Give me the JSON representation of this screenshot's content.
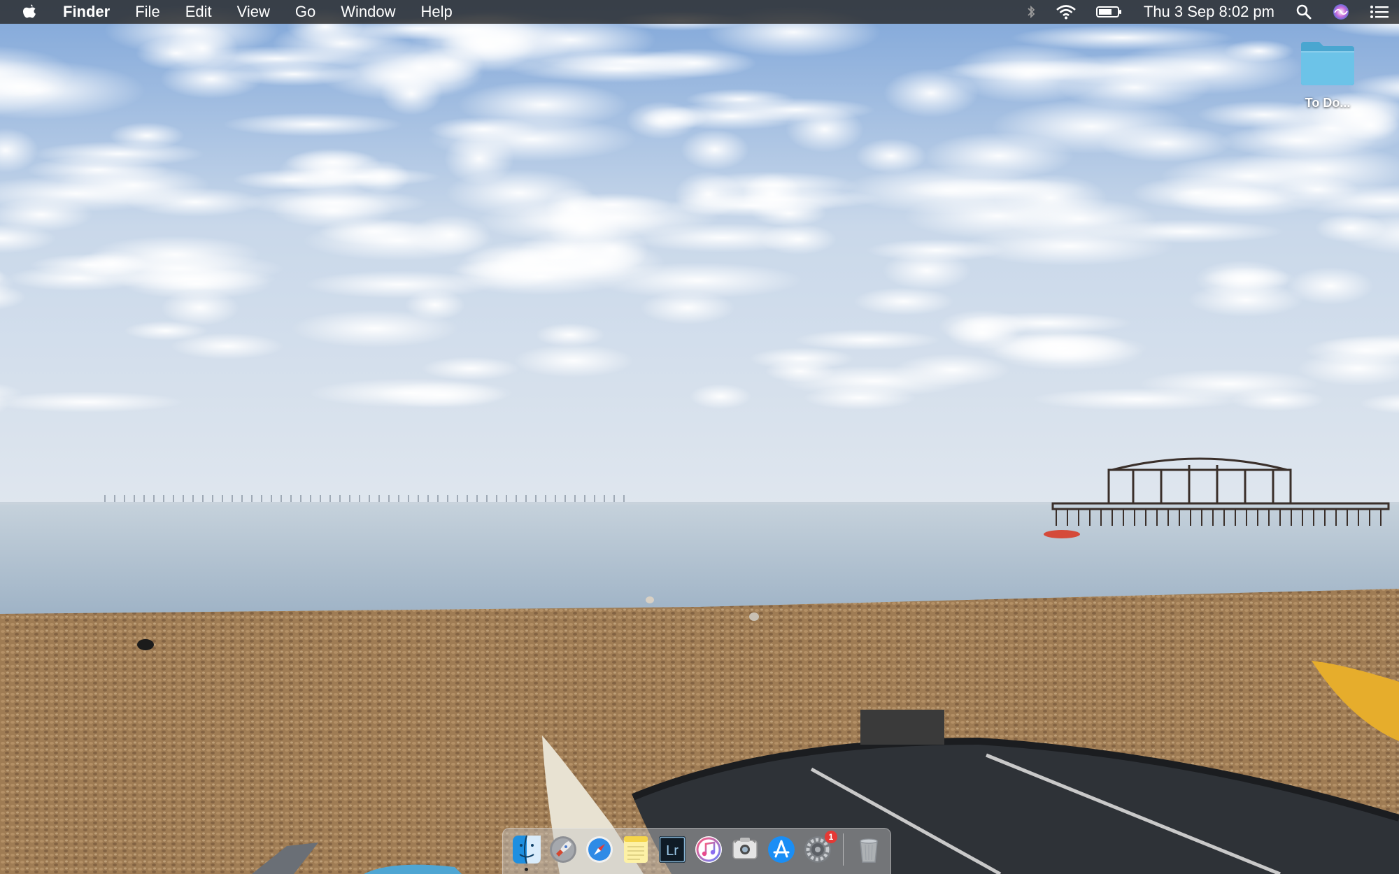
{
  "menubar": {
    "app_name": "Finder",
    "menus": [
      "File",
      "Edit",
      "View",
      "Go",
      "Window",
      "Help"
    ],
    "clock": "Thu 3 Sep  8:02 pm",
    "status_icons": [
      "bluetooth-icon",
      "wifi-icon",
      "battery-icon",
      "spotlight-search-icon",
      "siri-icon",
      "notification-center-icon"
    ]
  },
  "desktop": {
    "items": [
      {
        "label": "To Do...",
        "icon": "folder-icon"
      }
    ]
  },
  "dock": {
    "apps": [
      {
        "name": "finder-icon",
        "running": true
      },
      {
        "name": "launchpad-icon",
        "running": false
      },
      {
        "name": "safari-icon",
        "running": false
      },
      {
        "name": "notes-icon",
        "running": false
      },
      {
        "name": "lightroom-icon",
        "label": "Lr",
        "running": false
      },
      {
        "name": "itunes-icon",
        "running": false
      },
      {
        "name": "screenshot-icon",
        "running": false
      },
      {
        "name": "app-store-icon",
        "running": false
      },
      {
        "name": "system-preferences-icon",
        "badge": "1",
        "running": false
      },
      {
        "name": "trash-icon",
        "running": false
      }
    ]
  },
  "colors": {
    "menubar_bg": "#2b2b2b",
    "folder": "#5bb6dd",
    "sky": "#8fb3de",
    "sea": "#a9bccd",
    "pebbles": "#a8845a"
  }
}
